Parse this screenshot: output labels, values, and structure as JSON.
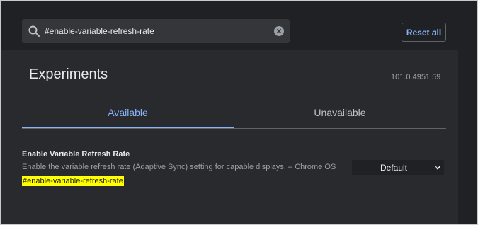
{
  "search": {
    "value": "#enable-variable-refresh-rate",
    "icon": "search-icon",
    "clear_icon": "close-icon"
  },
  "header": {
    "reset_label": "Reset all"
  },
  "page": {
    "title": "Experiments",
    "version": "101.0.4951.59"
  },
  "tabs": [
    {
      "label": "Available",
      "active": true
    },
    {
      "label": "Unavailable",
      "active": false
    }
  ],
  "experiment": {
    "name": "Enable Variable Refresh Rate",
    "description": "Enable the variable refresh rate (Adaptive Sync) setting for capable displays. – Chrome OS",
    "link": "#enable-variable-refresh-rate",
    "select_value": "Default"
  },
  "colors": {
    "accent": "#8ab4f8",
    "highlight": "#ffff00",
    "panel_bg": "#292a2d",
    "header_bg": "#202124"
  }
}
